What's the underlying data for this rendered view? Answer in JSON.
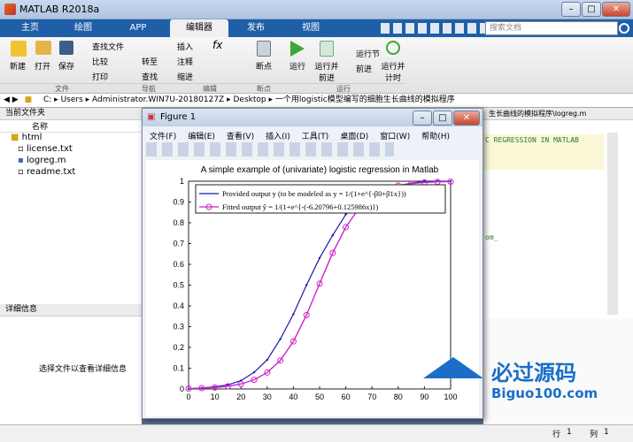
{
  "window": {
    "title": "MATLAB R2018a",
    "min": "–",
    "max": "□",
    "close": "✕"
  },
  "tabs": [
    "主页",
    "绘图",
    "APP",
    "编辑器",
    "发布",
    "视图"
  ],
  "search": {
    "placeholder": "搜索文档"
  },
  "ribbon": {
    "new": "新建",
    "open": "打开",
    "save": "保存",
    "find_files": "查找文件",
    "compare": "比较",
    "print": "打印",
    "goto": "转至",
    "find": "查找",
    "insert": "插入",
    "fx": "fx",
    "comment": "注释",
    "indent": "缩进",
    "breakpoint": "断点",
    "run": "运行",
    "run_advance": "运行并\n前进",
    "run_section": "运行节",
    "advance": "前进",
    "run_time": "运行并\n计时",
    "sections": [
      "文件",
      "导航",
      "编辑",
      "断点",
      "运行"
    ]
  },
  "address": {
    "path": [
      "C:",
      "Users",
      "Administrator.WIN7U-20180127Z",
      "Desktop",
      "一个用logistic模型编写的细胞生长曲线的模拟程序"
    ]
  },
  "current_folder": {
    "header": "当前文件夹",
    "col_name": "名称",
    "items": [
      {
        "name": "html",
        "type": "folder"
      },
      {
        "name": "license.txt",
        "type": "file"
      },
      {
        "name": "logreg.m",
        "type": "file"
      },
      {
        "name": "readme.txt",
        "type": "file"
      }
    ]
  },
  "details": {
    "header": "详细信息",
    "empty_text": "选择文件以查看详细信息"
  },
  "editor": {
    "tab_label": "生长曲线的模拟程序\\logreg.m",
    "code_snippet": "C REGRESSION IN MATLAB",
    "fragment": "om_"
  },
  "figure": {
    "title": "Figure 1",
    "menu": [
      "文件(F)",
      "编辑(E)",
      "查看(V)",
      "插入(I)",
      "工具(T)",
      "桌面(D)",
      "窗口(W)",
      "帮助(H)"
    ],
    "min": "–",
    "max": "□",
    "close": "✕"
  },
  "chart_data": {
    "type": "line",
    "title": "A simple example of (univariate) logistic regression in Matlab",
    "xlim": [
      0,
      100
    ],
    "ylim": [
      0,
      1
    ],
    "xticks": [
      0,
      10,
      20,
      30,
      40,
      50,
      60,
      70,
      80,
      90,
      100
    ],
    "yticks": [
      0,
      0.1,
      0.2,
      0.3,
      0.4,
      0.5,
      0.6,
      0.7,
      0.8,
      0.9,
      1
    ],
    "legend_position": "top",
    "series": [
      {
        "name": "Provided output y (to be modeled as y = 1/(1+e^{-β0+β1x}))",
        "color": "#1a1aa8",
        "x": [
          0,
          5,
          10,
          15,
          20,
          25,
          30,
          35,
          40,
          45,
          50,
          55,
          60,
          65,
          70,
          75,
          80,
          85,
          90,
          95,
          100
        ],
        "y": [
          0.0,
          0.005,
          0.01,
          0.02,
          0.04,
          0.08,
          0.14,
          0.24,
          0.36,
          0.5,
          0.63,
          0.74,
          0.84,
          0.9,
          0.94,
          0.97,
          0.98,
          0.99,
          1.0,
          1.0,
          1.0
        ]
      },
      {
        "name": "Fitted output ŷ = 1/(1+e^{-(-6.20796+0.125986x)})",
        "color": "#cc22cc",
        "x": [
          0,
          5,
          10,
          15,
          20,
          25,
          30,
          35,
          40,
          45,
          50,
          55,
          60,
          65,
          70,
          75,
          80,
          85,
          90,
          95,
          100
        ],
        "y": [
          0.002,
          0.004,
          0.007,
          0.013,
          0.024,
          0.044,
          0.079,
          0.137,
          0.229,
          0.356,
          0.507,
          0.655,
          0.779,
          0.869,
          0.927,
          0.961,
          0.979,
          0.989,
          0.994,
          0.997,
          0.998
        ]
      }
    ]
  },
  "statusbar": {
    "row_label": "行",
    "row": "1",
    "col_label": "列",
    "col": "1"
  },
  "watermark": {
    "text": "必过源码",
    "url": "Biguo100.com"
  }
}
